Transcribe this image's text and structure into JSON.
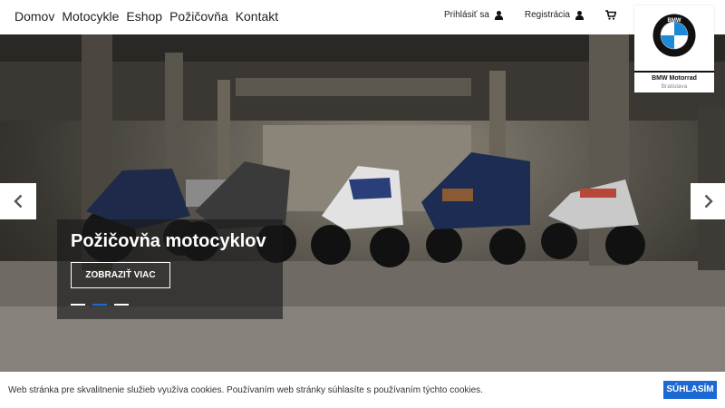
{
  "nav": {
    "items": [
      {
        "label": "Domov"
      },
      {
        "label": "Motocykle"
      },
      {
        "label": "Eshop"
      },
      {
        "label": "Požičovňa"
      },
      {
        "label": "Kontakt"
      }
    ]
  },
  "account": {
    "login_label": "Prihlásiť sa",
    "register_label": "Registrácia",
    "login_icon": "user-icon",
    "register_icon": "user-icon",
    "cart_icon": "cart-icon",
    "search_icon": "search-icon"
  },
  "logo": {
    "emblem_text": "BMW",
    "line1": "BMW Motorrad",
    "line2": "Bratislava"
  },
  "hero": {
    "title": "Požičovňa motocyklov",
    "button_label": "ZOBRAZIŤ VIAC",
    "slides": 3,
    "active_slide": 2,
    "prev_icon": "chevron-left-icon",
    "next_icon": "chevron-right-icon"
  },
  "cookie": {
    "text": "Web stránka pre skvalitnenie služieb využíva cookies. Používaním web stránky súhlasíte s používaním týchto cookies.",
    "accept_label": "SÚHLASÍM"
  },
  "colors": {
    "accent": "#1c69d4",
    "text": "#222222"
  }
}
